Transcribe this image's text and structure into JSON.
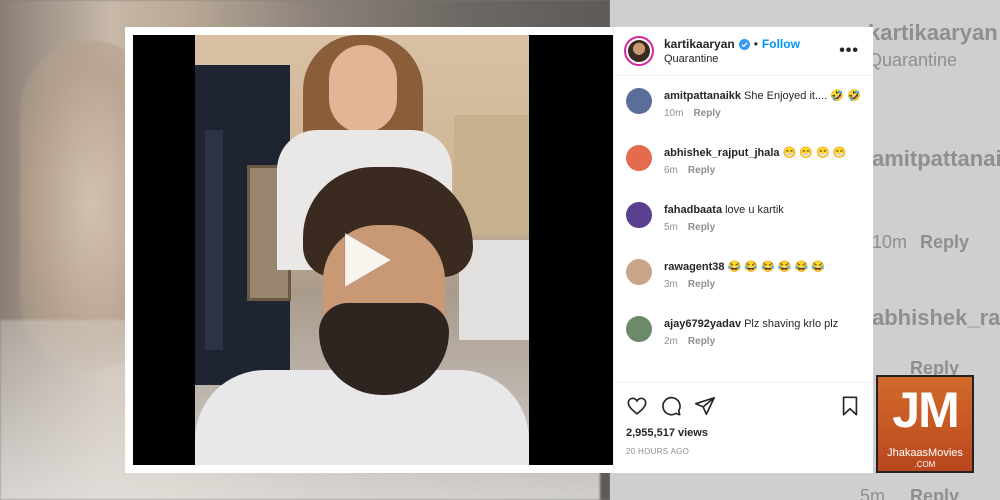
{
  "post": {
    "username": "kartikaaryan",
    "location": "Quarantine",
    "follow_label": "Follow",
    "dot": "•",
    "more": "•••"
  },
  "comments": [
    {
      "user": "amitpattanaikk",
      "text": "She Enjoyed it.... 🤣 🤣",
      "time": "10m",
      "reply": "Reply",
      "avatar_color": "#5b6e9a"
    },
    {
      "user": "abhishek_rajput_jhala",
      "text": "😁 😁 😁 😁",
      "time": "6m",
      "reply": "Reply",
      "avatar_color": "#e56b4f"
    },
    {
      "user": "fahadbaata",
      "text": "love u kartik",
      "time": "5m",
      "reply": "Reply",
      "avatar_color": "#5a3f8f"
    },
    {
      "user": "rawagent38",
      "text": "😂 😂 😂 😂 😂 😂",
      "time": "3m",
      "reply": "Reply",
      "avatar_color": "#c9a58a"
    },
    {
      "user": "ajay6792yadav",
      "text": "Plz shaving krlo plz",
      "time": "2m",
      "reply": "Reply",
      "avatar_color": "#6c8a6a"
    }
  ],
  "stats": {
    "views": "2,955,517 views",
    "posted": "20 HOURS AGO"
  },
  "background_ghost": {
    "username": "kartikaaryan",
    "location": "Quarantine",
    "commenter": "amitpattanai",
    "time": "10m",
    "reply": "Reply",
    "commenter2": "abhishek_rajpu",
    "reply2": "Reply",
    "time2": "5m",
    "reply3": "Reply"
  },
  "watermark": {
    "logo": "JM",
    "site": "JhakaasMovies",
    "tld": ".COM"
  },
  "colors": {
    "accent": "#0095f6",
    "verified": "#3897f0",
    "watermark": "#c9562a"
  }
}
